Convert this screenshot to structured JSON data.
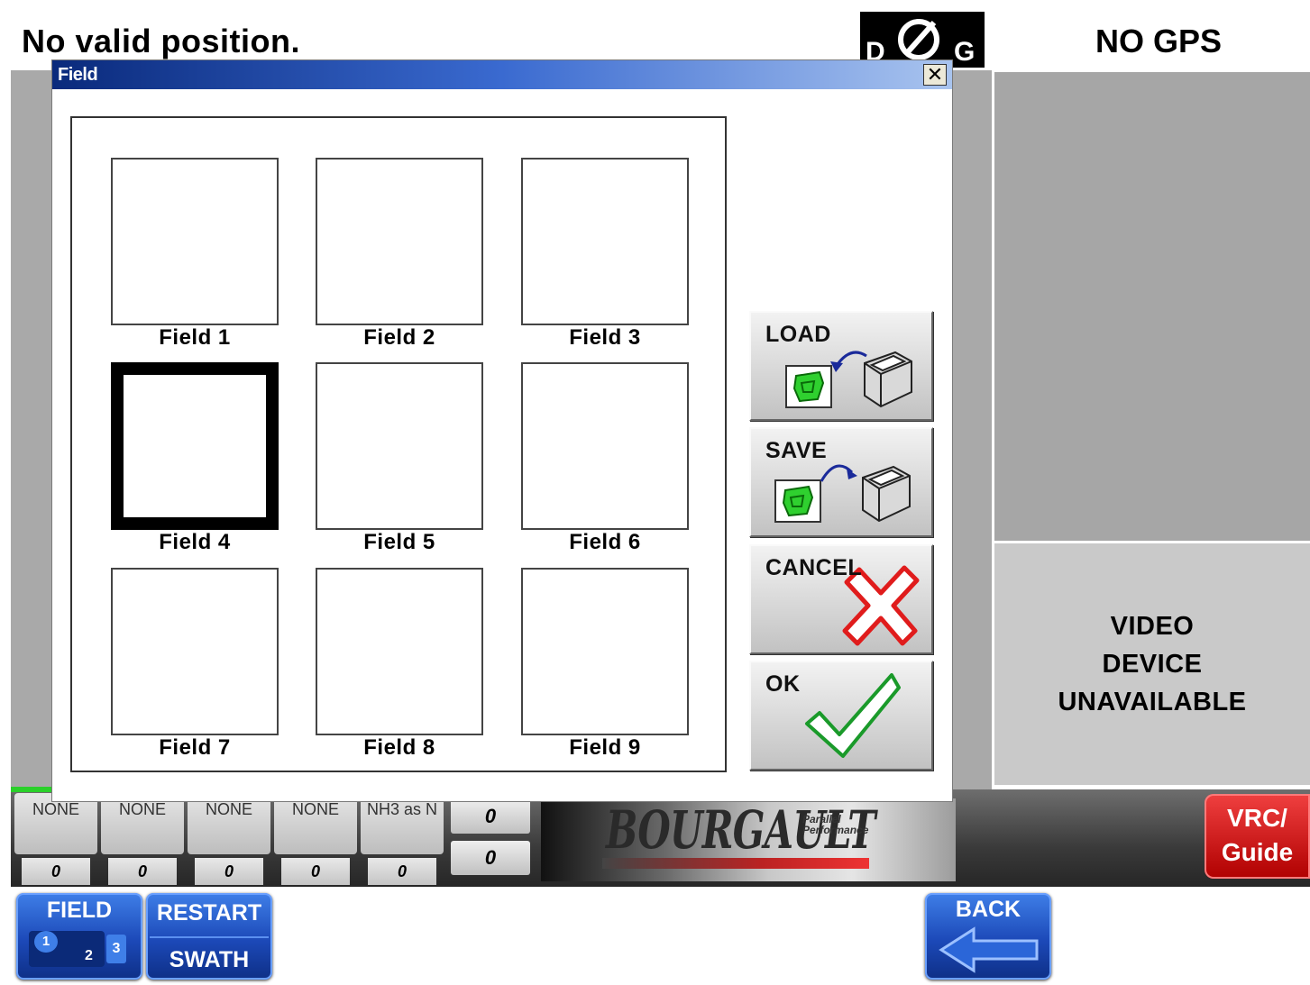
{
  "header": {
    "status_message": "No valid position.",
    "dgps_badge_letters": [
      "D",
      "G"
    ],
    "gps_status": "NO GPS"
  },
  "video_panel": {
    "lines": [
      "VIDEO",
      "DEVICE",
      "UNAVAILABLE"
    ]
  },
  "instrument_bar": {
    "products": [
      {
        "name": "NONE",
        "value": "0"
      },
      {
        "name": "NONE",
        "value": "0"
      },
      {
        "name": "NONE",
        "value": "0"
      },
      {
        "name": "NONE",
        "value": "0"
      },
      {
        "name": "NH3 as N",
        "value": "0"
      }
    ],
    "rates": [
      "0",
      "0"
    ],
    "brand_name": "BOURGAULT",
    "brand_tagline": [
      "Parallel",
      "Performance"
    ],
    "vrc_button": [
      "VRC/",
      "Guide"
    ]
  },
  "nav": {
    "field_label": "FIELD",
    "field_pages": [
      "1",
      "2",
      "3"
    ],
    "restart_line1": "RESTART",
    "restart_line2": "SWATH",
    "back_label": "BACK"
  },
  "dialog": {
    "title": "Field",
    "close_glyph": "✕",
    "fields": [
      "Field 1",
      "Field 2",
      "Field 3",
      "Field 4",
      "Field 5",
      "Field 6",
      "Field 7",
      "Field 8",
      "Field 9"
    ],
    "selected_field": "Field 4",
    "buttons": {
      "load": "LOAD",
      "save": "SAVE",
      "cancel": "CANCEL",
      "ok": "OK"
    }
  },
  "colors": {
    "title_bar": "#0a2a7c",
    "nav_blue": "#1c49b8",
    "vrc_red": "#d01818",
    "field_icon_green": "#2fd02f"
  },
  "icons": [
    "field-map-icon",
    "disk-drive-icon",
    "load-arrow-icon",
    "save-arrow-icon",
    "red-x-icon",
    "green-check-icon",
    "back-arrow-icon",
    "close-icon",
    "no-gps-symbol-icon"
  ]
}
